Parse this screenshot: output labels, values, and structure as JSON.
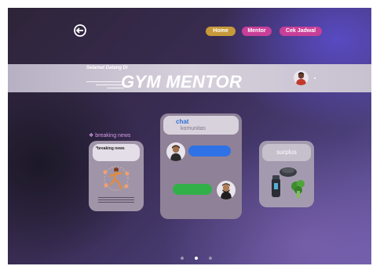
{
  "nav": {
    "home_label": "Home",
    "mentor_label": "Mentor",
    "jadwal_label": "Cek Jadwal"
  },
  "banner": {
    "welcome": "Selamat Datang  Di",
    "title": "GYM MENTOR"
  },
  "news": {
    "section_label": "breaking news",
    "section_icon": "diamond-icon",
    "card_title": "*breaking news"
  },
  "chat": {
    "title": "chat",
    "subtitle": "komunitas"
  },
  "surplus": {
    "title": "surplus"
  },
  "pager": {
    "count": 3,
    "active": 2
  },
  "colors": {
    "home_button": "#c79a3a",
    "nav_buttons": "#c83f98",
    "chat_blue": "#2e72e6",
    "chat_green": "#31b04a"
  }
}
